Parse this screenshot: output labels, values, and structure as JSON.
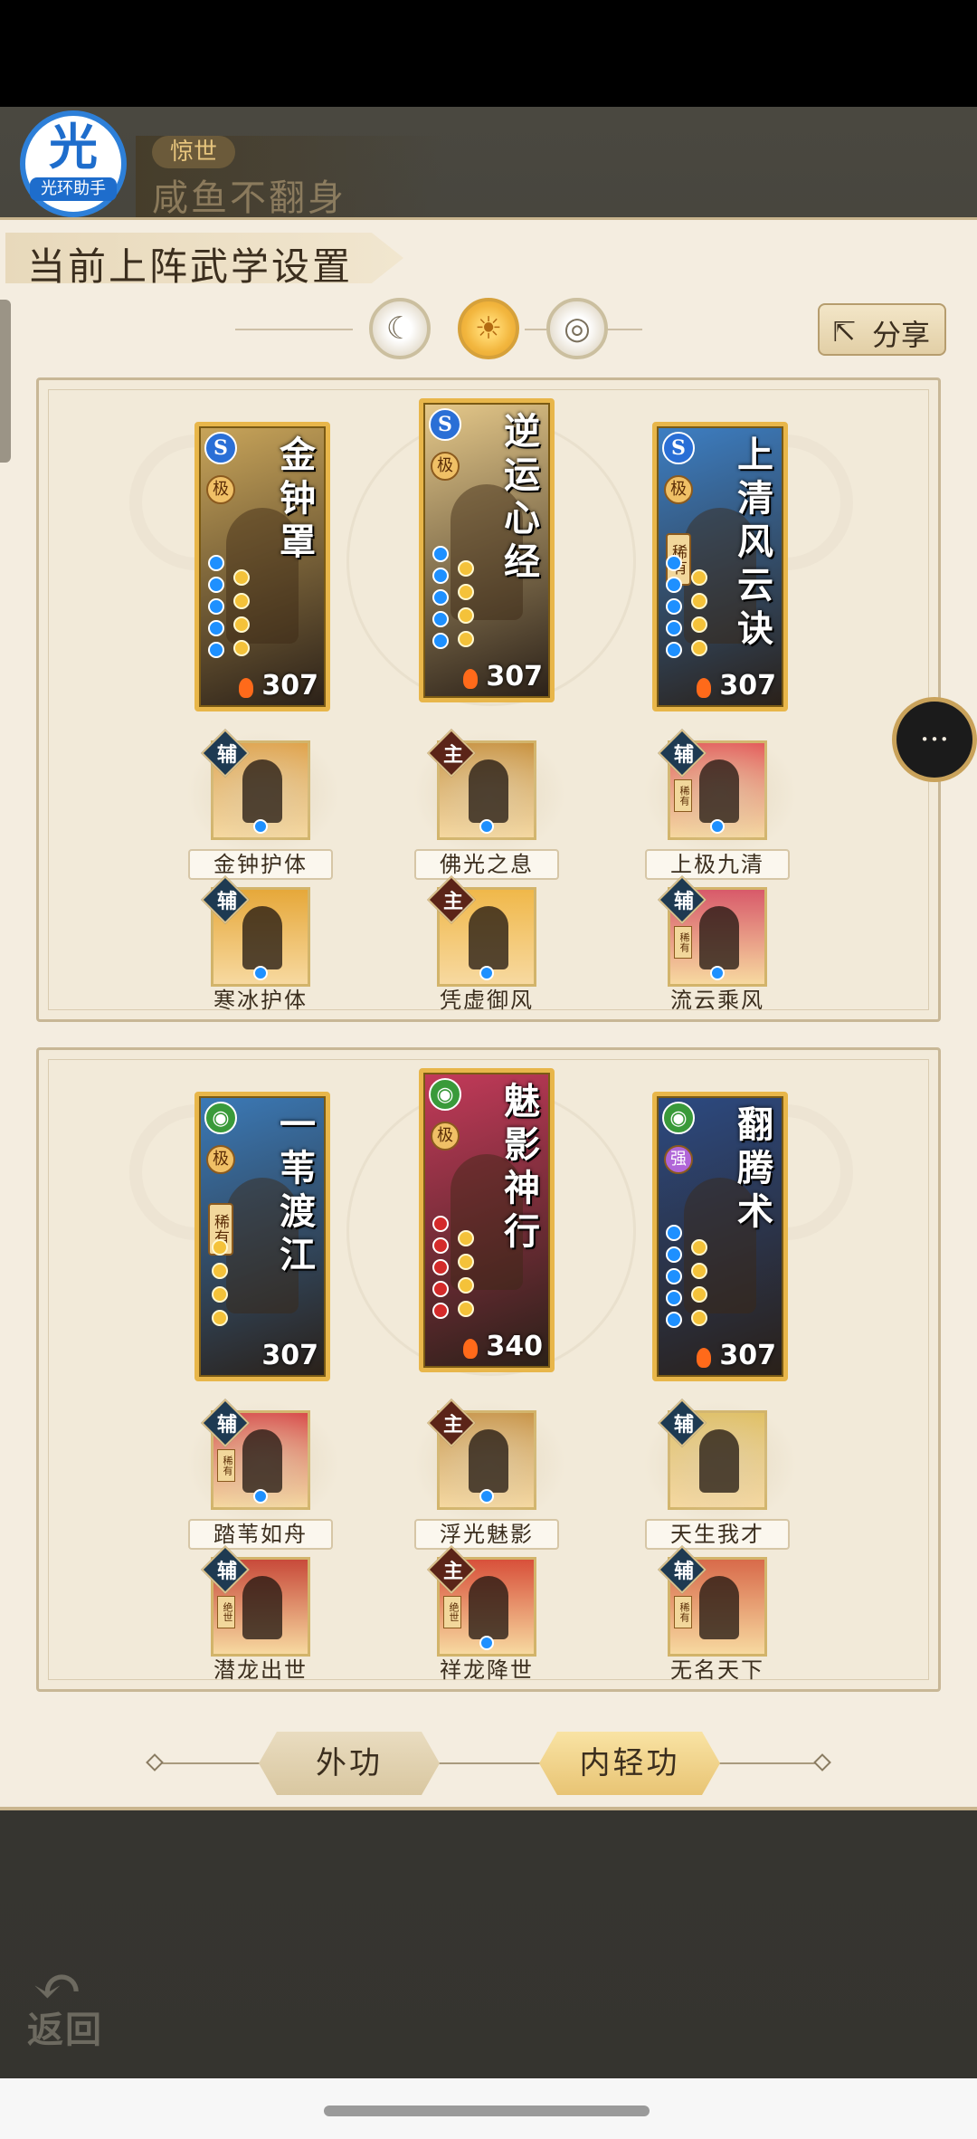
{
  "player": {
    "title_tag": "惊世",
    "name": "咸鱼不翻身"
  },
  "app_badge": {
    "glyph": "光",
    "label": "光环助手"
  },
  "panel": {
    "title": "当前上阵武学设置",
    "share_label": "分享",
    "share_icon": "share-icon"
  },
  "discs": [
    {
      "name": "moon",
      "glyph": "☾",
      "active": false
    },
    {
      "name": "sun",
      "glyph": "☀",
      "active": true
    },
    {
      "name": "ring",
      "glyph": "◎",
      "active": false
    }
  ],
  "group1": {
    "cards": [
      {
        "title": "金钟罩",
        "rank": "极",
        "power": "307",
        "school": "S",
        "school_color": "#2a6fd6",
        "bg": "#c9a55a",
        "rare": ""
      },
      {
        "title": "逆运心经",
        "rank": "极",
        "power": "307",
        "school": "S",
        "school_color": "#2a6fd6",
        "bg": "#e6c98a",
        "rare": ""
      },
      {
        "title": "上清风云诀",
        "rank": "极",
        "power": "307",
        "school": "S",
        "school_color": "#2a6fd6",
        "bg": "#3d7fc4",
        "rare": "稀有"
      }
    ],
    "skills": [
      {
        "label": "金钟护体",
        "badge": "辅",
        "type": "aux",
        "bg": "#e0a24a",
        "sub": ""
      },
      {
        "label": "佛光之息",
        "badge": "主",
        "type": "main",
        "bg": "#c8913e",
        "sub": ""
      },
      {
        "label": "上极九清",
        "badge": "辅",
        "type": "aux",
        "bg": "#e45a5a",
        "sub": "稀有"
      },
      {
        "label": "寒冰护体",
        "badge": "辅",
        "type": "aux",
        "bg": "#e6a83a",
        "sub": ""
      },
      {
        "label": "凭虚御风",
        "badge": "主",
        "type": "main",
        "bg": "#f0b84a",
        "sub": ""
      },
      {
        "label": "流云乘风",
        "badge": "辅",
        "type": "aux",
        "bg": "#d85a6a",
        "sub": "稀有"
      }
    ]
  },
  "group2": {
    "cards": [
      {
        "title": "一苇渡江",
        "rank": "极",
        "power": "307",
        "school": "◉",
        "school_color": "#3a9a3a",
        "bg": "#3b7ab8",
        "rare": "稀有"
      },
      {
        "title": "魅影神行",
        "rank": "极",
        "power": "340",
        "school": "◉",
        "school_color": "#3a9a3a",
        "bg": "#c43a5a",
        "rare": ""
      },
      {
        "title": "翻腾术",
        "rank": "强",
        "power": "307",
        "school": "◉",
        "school_color": "#3a9a3a",
        "bg": "#2c4a82",
        "rare": ""
      }
    ],
    "skills": [
      {
        "label": "踏苇如舟",
        "badge": "辅",
        "type": "aux",
        "bg": "#d84a4a",
        "sub": "稀有"
      },
      {
        "label": "浮光魅影",
        "badge": "主",
        "type": "main",
        "bg": "#c89448",
        "sub": ""
      },
      {
        "label": "天生我才",
        "badge": "辅",
        "type": "aux",
        "bg": "#e0c064",
        "sub": ""
      },
      {
        "label": "潜龙出世",
        "badge": "辅",
        "type": "aux",
        "bg": "#c84a3a",
        "sub": "绝世"
      },
      {
        "label": "祥龙降世",
        "badge": "主",
        "type": "main",
        "bg": "#d8503a",
        "sub": "绝世"
      },
      {
        "label": "无名天下",
        "badge": "辅",
        "type": "aux",
        "bg": "#d86a4a",
        "sub": "稀有"
      }
    ]
  },
  "tabs": [
    {
      "label": "外功",
      "active": false
    },
    {
      "label": "内轻功",
      "active": true
    }
  ],
  "chat_icon": "chat-bubble-icon",
  "back": {
    "label": "返回",
    "icon": "back-arrow-icon"
  }
}
